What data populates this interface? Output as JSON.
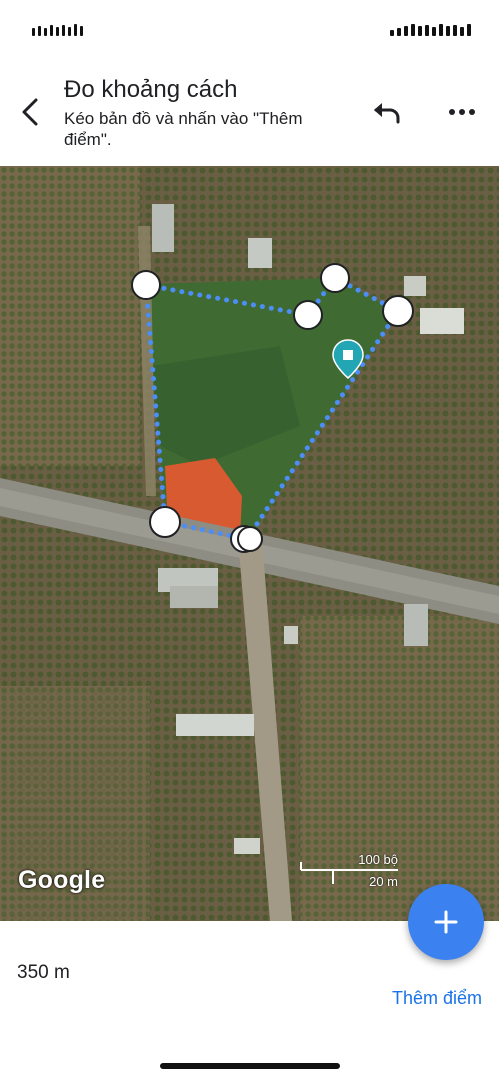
{
  "header": {
    "title": "Đo khoảng cách",
    "subtitle": "Kéo bản đồ và nhấn vào \"Thêm điểm\"."
  },
  "map": {
    "logo_text": "Google",
    "scale": {
      "top_label": "100 bộ",
      "bottom_label": "20 m"
    },
    "pin_color": "#22a6b3",
    "measure_line_color": "#4c8df6"
  },
  "bottom": {
    "distance": "350 m",
    "add_point_label": "Thêm điểm"
  },
  "colors": {
    "accent": "#1a73e8",
    "fab": "#3b82f0"
  }
}
